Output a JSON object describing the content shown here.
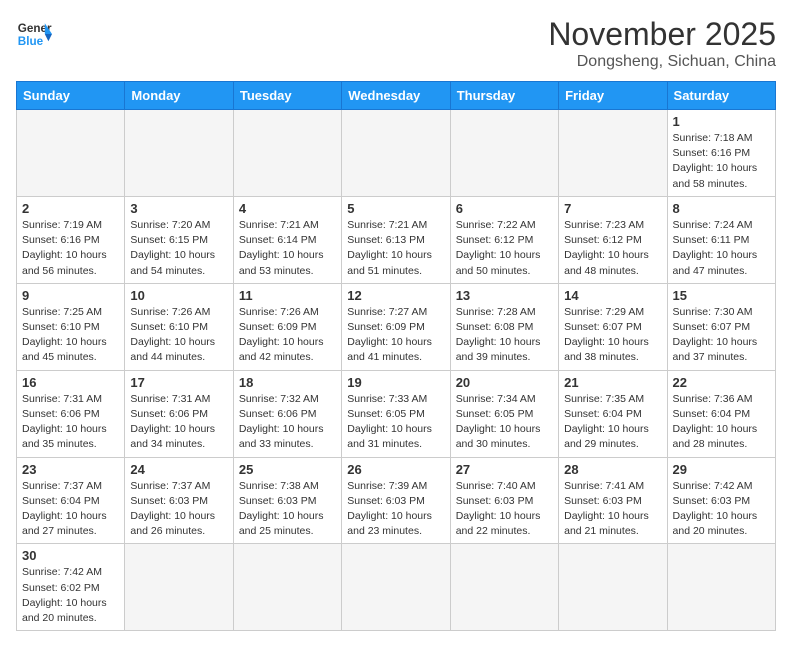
{
  "logo": {
    "line1": "General",
    "line2": "Blue"
  },
  "title": "November 2025",
  "subtitle": "Dongsheng, Sichuan, China",
  "headers": [
    "Sunday",
    "Monday",
    "Tuesday",
    "Wednesday",
    "Thursday",
    "Friday",
    "Saturday"
  ],
  "days": [
    {
      "num": "",
      "info": ""
    },
    {
      "num": "",
      "info": ""
    },
    {
      "num": "",
      "info": ""
    },
    {
      "num": "",
      "info": ""
    },
    {
      "num": "",
      "info": ""
    },
    {
      "num": "",
      "info": ""
    },
    {
      "num": "1",
      "info": "Sunrise: 7:18 AM\nSunset: 6:16 PM\nDaylight: 10 hours\nand 58 minutes."
    },
    {
      "num": "2",
      "info": "Sunrise: 7:19 AM\nSunset: 6:16 PM\nDaylight: 10 hours\nand 56 minutes."
    },
    {
      "num": "3",
      "info": "Sunrise: 7:20 AM\nSunset: 6:15 PM\nDaylight: 10 hours\nand 54 minutes."
    },
    {
      "num": "4",
      "info": "Sunrise: 7:21 AM\nSunset: 6:14 PM\nDaylight: 10 hours\nand 53 minutes."
    },
    {
      "num": "5",
      "info": "Sunrise: 7:21 AM\nSunset: 6:13 PM\nDaylight: 10 hours\nand 51 minutes."
    },
    {
      "num": "6",
      "info": "Sunrise: 7:22 AM\nSunset: 6:12 PM\nDaylight: 10 hours\nand 50 minutes."
    },
    {
      "num": "7",
      "info": "Sunrise: 7:23 AM\nSunset: 6:12 PM\nDaylight: 10 hours\nand 48 minutes."
    },
    {
      "num": "8",
      "info": "Sunrise: 7:24 AM\nSunset: 6:11 PM\nDaylight: 10 hours\nand 47 minutes."
    },
    {
      "num": "9",
      "info": "Sunrise: 7:25 AM\nSunset: 6:10 PM\nDaylight: 10 hours\nand 45 minutes."
    },
    {
      "num": "10",
      "info": "Sunrise: 7:26 AM\nSunset: 6:10 PM\nDaylight: 10 hours\nand 44 minutes."
    },
    {
      "num": "11",
      "info": "Sunrise: 7:26 AM\nSunset: 6:09 PM\nDaylight: 10 hours\nand 42 minutes."
    },
    {
      "num": "12",
      "info": "Sunrise: 7:27 AM\nSunset: 6:09 PM\nDaylight: 10 hours\nand 41 minutes."
    },
    {
      "num": "13",
      "info": "Sunrise: 7:28 AM\nSunset: 6:08 PM\nDaylight: 10 hours\nand 39 minutes."
    },
    {
      "num": "14",
      "info": "Sunrise: 7:29 AM\nSunset: 6:07 PM\nDaylight: 10 hours\nand 38 minutes."
    },
    {
      "num": "15",
      "info": "Sunrise: 7:30 AM\nSunset: 6:07 PM\nDaylight: 10 hours\nand 37 minutes."
    },
    {
      "num": "16",
      "info": "Sunrise: 7:31 AM\nSunset: 6:06 PM\nDaylight: 10 hours\nand 35 minutes."
    },
    {
      "num": "17",
      "info": "Sunrise: 7:31 AM\nSunset: 6:06 PM\nDaylight: 10 hours\nand 34 minutes."
    },
    {
      "num": "18",
      "info": "Sunrise: 7:32 AM\nSunset: 6:06 PM\nDaylight: 10 hours\nand 33 minutes."
    },
    {
      "num": "19",
      "info": "Sunrise: 7:33 AM\nSunset: 6:05 PM\nDaylight: 10 hours\nand 31 minutes."
    },
    {
      "num": "20",
      "info": "Sunrise: 7:34 AM\nSunset: 6:05 PM\nDaylight: 10 hours\nand 30 minutes."
    },
    {
      "num": "21",
      "info": "Sunrise: 7:35 AM\nSunset: 6:04 PM\nDaylight: 10 hours\nand 29 minutes."
    },
    {
      "num": "22",
      "info": "Sunrise: 7:36 AM\nSunset: 6:04 PM\nDaylight: 10 hours\nand 28 minutes."
    },
    {
      "num": "23",
      "info": "Sunrise: 7:37 AM\nSunset: 6:04 PM\nDaylight: 10 hours\nand 27 minutes."
    },
    {
      "num": "24",
      "info": "Sunrise: 7:37 AM\nSunset: 6:03 PM\nDaylight: 10 hours\nand 26 minutes."
    },
    {
      "num": "25",
      "info": "Sunrise: 7:38 AM\nSunset: 6:03 PM\nDaylight: 10 hours\nand 25 minutes."
    },
    {
      "num": "26",
      "info": "Sunrise: 7:39 AM\nSunset: 6:03 PM\nDaylight: 10 hours\nand 23 minutes."
    },
    {
      "num": "27",
      "info": "Sunrise: 7:40 AM\nSunset: 6:03 PM\nDaylight: 10 hours\nand 22 minutes."
    },
    {
      "num": "28",
      "info": "Sunrise: 7:41 AM\nSunset: 6:03 PM\nDaylight: 10 hours\nand 21 minutes."
    },
    {
      "num": "29",
      "info": "Sunrise: 7:42 AM\nSunset: 6:03 PM\nDaylight: 10 hours\nand 20 minutes."
    },
    {
      "num": "30",
      "info": "Sunrise: 7:42 AM\nSunset: 6:02 PM\nDaylight: 10 hours\nand 20 minutes."
    },
    {
      "num": "",
      "info": ""
    },
    {
      "num": "",
      "info": ""
    },
    {
      "num": "",
      "info": ""
    },
    {
      "num": "",
      "info": ""
    },
    {
      "num": "",
      "info": ""
    },
    {
      "num": "",
      "info": ""
    }
  ]
}
